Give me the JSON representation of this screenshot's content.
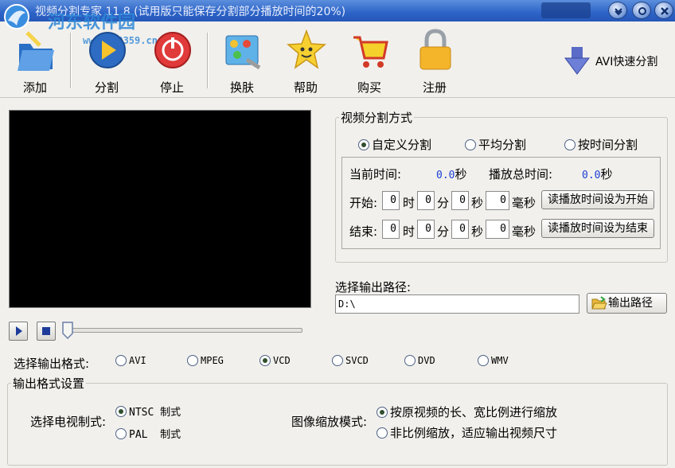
{
  "window": {
    "title": "视频分割专家 11.8 (试用版只能保存分割部分播放时间的20%)",
    "watermark": "河东软件园",
    "watermark_url": "www.pc0359.cn"
  },
  "toolbar": {
    "add": "添加",
    "split": "分割",
    "stop": "停止",
    "skin": "换肤",
    "help": "帮助",
    "buy": "购买",
    "register": "注册",
    "avi_fast": "AVI快速分割"
  },
  "split_mode": {
    "legend": "视频分割方式",
    "options": [
      "自定义分割",
      "平均分割",
      "按时间分割"
    ],
    "selected": "自定义分割",
    "current_time_label": "当前时间:",
    "current_time_value": "0.0",
    "total_time_label": "播放总时间:",
    "total_time_value": "0.0",
    "sec_unit": "秒",
    "start_label": "开始:",
    "end_label": "结束:",
    "units": {
      "hour": "时",
      "min": "分",
      "sec": "秒",
      "ms": "毫秒"
    },
    "start": {
      "h": "0",
      "m": "0",
      "s": "0",
      "ms": "0"
    },
    "end": {
      "h": "0",
      "m": "0",
      "s": "0",
      "ms": "0"
    },
    "set_start_button": "读播放时间设为开始",
    "set_end_button": "读播放时间设为结束"
  },
  "output_path": {
    "label": "选择输出路径:",
    "value": "D:\\",
    "button": "输出路径"
  },
  "format": {
    "label": "选择输出格式:",
    "options": [
      "AVI",
      "MPEG",
      "VCD",
      "SVCD",
      "DVD",
      "WMV"
    ],
    "selected": "VCD"
  },
  "format_settings": {
    "legend": "输出格式设置",
    "tv_label": "选择电视制式:",
    "tv_options": [
      "NTSC 制式",
      "PAL  制式"
    ],
    "tv_selected": "NTSC 制式",
    "scale_label": "图像缩放模式:",
    "scale_options": [
      "按原视频的长、宽比例进行缩放",
      "非比例缩放，适应输出视频尺寸"
    ],
    "scale_selected": "按原视频的长、宽比例进行缩放"
  },
  "colors": {
    "title_bar": "#2d63c7",
    "time_value": "#1c3fd6",
    "background": "#f1f0ec"
  }
}
